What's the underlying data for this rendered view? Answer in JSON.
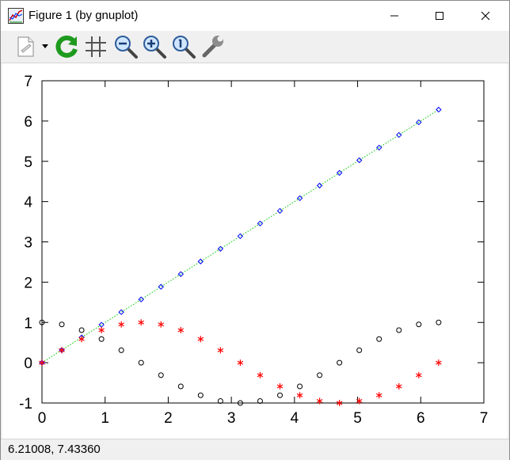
{
  "window": {
    "title": "Figure 1 (by gnuplot)",
    "controls": [
      "minimize-icon",
      "maximize-icon",
      "close-icon"
    ]
  },
  "toolbar": {
    "tools": [
      "new-page-icon",
      "dropdown-arrow-icon",
      "replot-icon",
      "grid-icon",
      "zoom-out-icon",
      "zoom-in-icon",
      "zoom-reset-icon",
      "settings-wrench-icon"
    ]
  },
  "status": {
    "coordinates": "6.21008,  7.43360"
  },
  "chart_data": {
    "type": "scatter",
    "xlim": [
      0,
      7
    ],
    "ylim": [
      -1,
      7
    ],
    "xticks": [
      "0",
      "1",
      "2",
      "3",
      "4",
      "5",
      "6",
      "7"
    ],
    "yticks": [
      "-1",
      "0",
      "1",
      "2",
      "3",
      "4",
      "5",
      "6",
      "7"
    ],
    "grid": false,
    "x": [
      0,
      0.3142,
      0.6283,
      0.9425,
      1.2566,
      1.5708,
      1.885,
      2.1991,
      2.5133,
      2.8274,
      3.1416,
      3.4558,
      3.7699,
      4.0841,
      4.3982,
      4.7124,
      5.0265,
      5.3407,
      5.6549,
      5.969,
      6.2832
    ],
    "series": [
      {
        "style": "line-with-diamonds",
        "line_color": "#00cc00",
        "marker_color": "#0000ff",
        "values": [
          0,
          0.3142,
          0.6283,
          0.9425,
          1.2566,
          1.5708,
          1.885,
          2.1991,
          2.5133,
          2.8274,
          3.1416,
          3.4558,
          3.7699,
          4.0841,
          4.3982,
          4.7124,
          5.0265,
          5.3407,
          5.6549,
          5.969,
          6.2832
        ]
      },
      {
        "style": "asterisks",
        "marker_color": "#ff0000",
        "values": [
          0,
          0.309,
          0.5878,
          0.809,
          0.9511,
          1,
          0.9511,
          0.809,
          0.5878,
          0.309,
          0,
          -0.309,
          -0.5878,
          -0.809,
          -0.9511,
          -1,
          -0.9511,
          -0.809,
          -0.5878,
          -0.309,
          0
        ]
      },
      {
        "style": "circles",
        "marker_color": "#000000",
        "values": [
          1,
          0.9511,
          0.809,
          0.5878,
          0.309,
          0,
          -0.309,
          -0.5878,
          -0.809,
          -0.9511,
          -1,
          -0.9511,
          -0.809,
          -0.5878,
          -0.309,
          0,
          0.309,
          0.5878,
          0.809,
          0.9511,
          1
        ]
      }
    ]
  }
}
